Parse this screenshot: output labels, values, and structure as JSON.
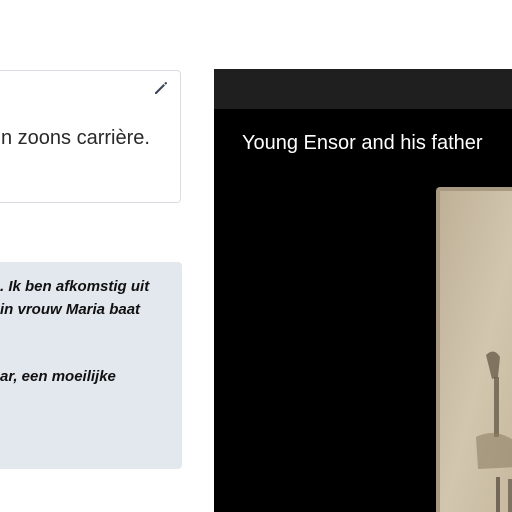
{
  "text_card": {
    "text": "n zoons carrière.",
    "edit_icon": "pencil-icon"
  },
  "quote": {
    "lines": [
      ". Ik ben afkomstig uit",
      "in vrouw Maria baat",
      "",
      "ar, een moeilijke"
    ]
  },
  "viewer": {
    "caption": "Young Ensor and his father"
  },
  "colors": {
    "card_border": "#d9dde3",
    "quote_bg": "#e3e7ee",
    "viewer_bg": "#000000",
    "viewer_bar": "#1f1f1f",
    "photo_sepia": "#c9bca3"
  }
}
